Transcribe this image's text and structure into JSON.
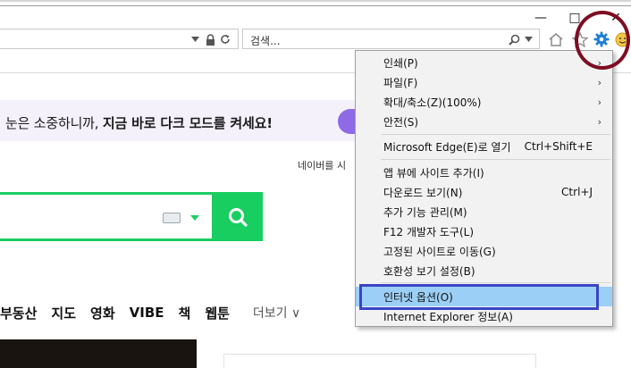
{
  "window": {
    "minimize_label": "—",
    "maximize_label": "□",
    "close_label": "✕"
  },
  "addressbar": {
    "search_text": "검색..."
  },
  "page": {
    "banner_prefix": "눈은 소중하니까, ",
    "banner_bold": "지금 바로 다크 모드를 켜세요!",
    "login_link": "네이버를 시",
    "nav_items": [
      "부동산",
      "지도",
      "영화",
      "VIBE",
      "책",
      "웹툰"
    ],
    "more_label": "더보기 ∨"
  },
  "menu": {
    "items": [
      {
        "label": "인쇄(P)",
        "shortcut": "",
        "arrow": "›"
      },
      {
        "label": "파일(F)",
        "shortcut": "",
        "arrow": "›"
      },
      {
        "label": "확대/축소(Z)(100%)",
        "shortcut": "",
        "arrow": "›"
      },
      {
        "label": "안전(S)",
        "shortcut": "",
        "arrow": "›"
      },
      {
        "label": "Microsoft Edge(E)로 열기",
        "shortcut": "Ctrl+Shift+E",
        "arrow": ""
      },
      {
        "label": "앱 뷰에 사이트 추가(I)",
        "shortcut": "",
        "arrow": ""
      },
      {
        "label": "다운로드 보기(N)",
        "shortcut": "Ctrl+J",
        "arrow": ""
      },
      {
        "label": "추가 기능 관리(M)",
        "shortcut": "",
        "arrow": ""
      },
      {
        "label": "F12 개발자 도구(L)",
        "shortcut": "",
        "arrow": ""
      },
      {
        "label": "고정된 사이트로 이동(G)",
        "shortcut": "",
        "arrow": ""
      },
      {
        "label": "호환성 보기 설정(B)",
        "shortcut": "",
        "arrow": ""
      },
      {
        "label": "인터넷 옵션(O)",
        "shortcut": "",
        "arrow": ""
      },
      {
        "label": "Internet Explorer 정보(A)",
        "shortcut": "",
        "arrow": ""
      }
    ],
    "highlighted_item": "인터넷 옵션(O)"
  },
  "colors": {
    "naver_green": "#19ce60",
    "menu_highlight": "#9ccff5",
    "annotation_box": "#3a44c6",
    "annotation_circle": "#7d0d23",
    "gear_blue": "#1e7fd8"
  },
  "icons": [
    "home-icon",
    "star-icon",
    "gear-icon",
    "smiley-icon",
    "search-icon",
    "lock-icon",
    "refresh-icon",
    "dropdown-arrow-icon",
    "keyboard-icon"
  ]
}
